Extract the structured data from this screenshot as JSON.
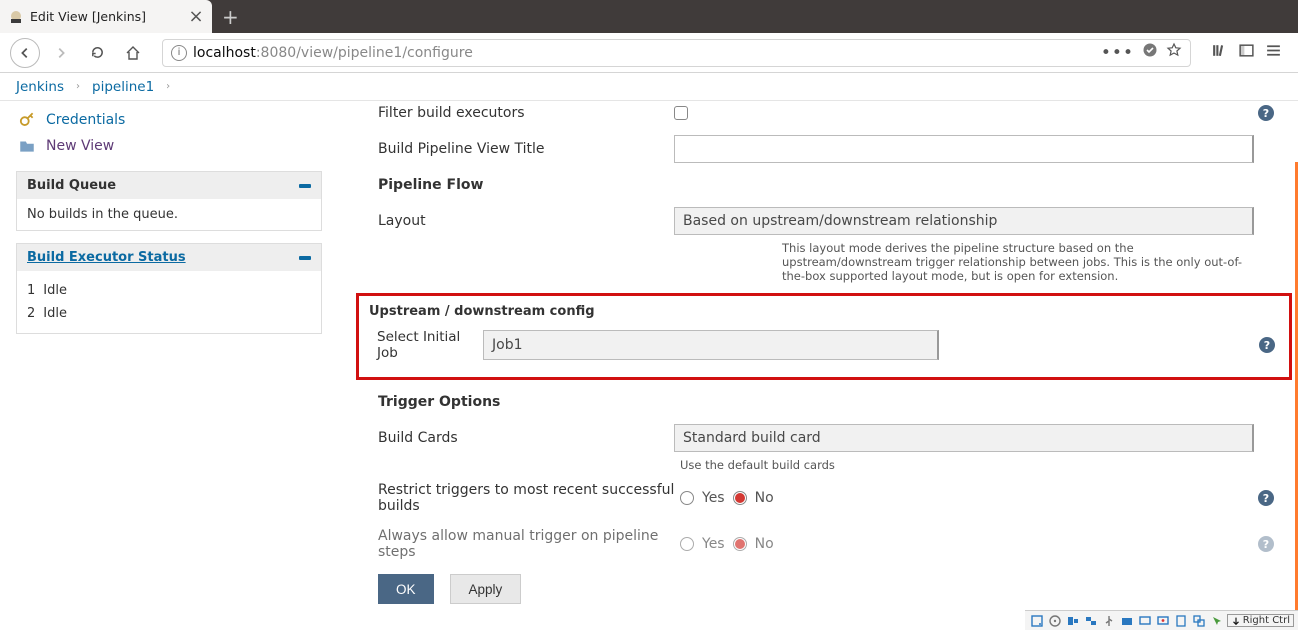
{
  "browser": {
    "tab_title": "Edit View [Jenkins]",
    "url_host": "localhost",
    "url_port": ":8080",
    "url_path": "/view/pipeline1/configure"
  },
  "breadcrumb": {
    "root": "Jenkins",
    "item": "pipeline1"
  },
  "sidebar": {
    "credentials_label": "Credentials",
    "new_view_label": "New View",
    "build_queue_title": "Build Queue",
    "build_queue_empty": "No builds in the queue.",
    "executor_title": "Build Executor Status",
    "executors": [
      {
        "num": "1",
        "state": "Idle"
      },
      {
        "num": "2",
        "state": "Idle"
      }
    ]
  },
  "form": {
    "filter_executors_label": "Filter build executors",
    "view_title_label": "Build Pipeline View Title",
    "view_title_value": "",
    "pipeline_flow_heading": "Pipeline Flow",
    "layout_label": "Layout",
    "layout_value": "Based on upstream/downstream relationship",
    "layout_desc": "This layout mode derives the pipeline structure based on the upstream/downstream trigger relationship between jobs. This is the only out-of-the-box supported layout mode, but is open for extension.",
    "upstream_heading": "Upstream / downstream config",
    "initial_job_label": "Select Initial Job",
    "initial_job_value": "Job1",
    "trigger_heading": "Trigger Options",
    "build_cards_label": "Build Cards",
    "build_cards_value": "Standard build card",
    "build_cards_desc": "Use the default build cards",
    "restrict_label": "Restrict triggers to most recent successful builds",
    "manual_trigger_label": "Always allow manual trigger on pipeline steps",
    "yes": "Yes",
    "no": "No",
    "ok_label": "OK",
    "apply_label": "Apply"
  },
  "statusbar": {
    "right_ctrl": "Right Ctrl"
  }
}
